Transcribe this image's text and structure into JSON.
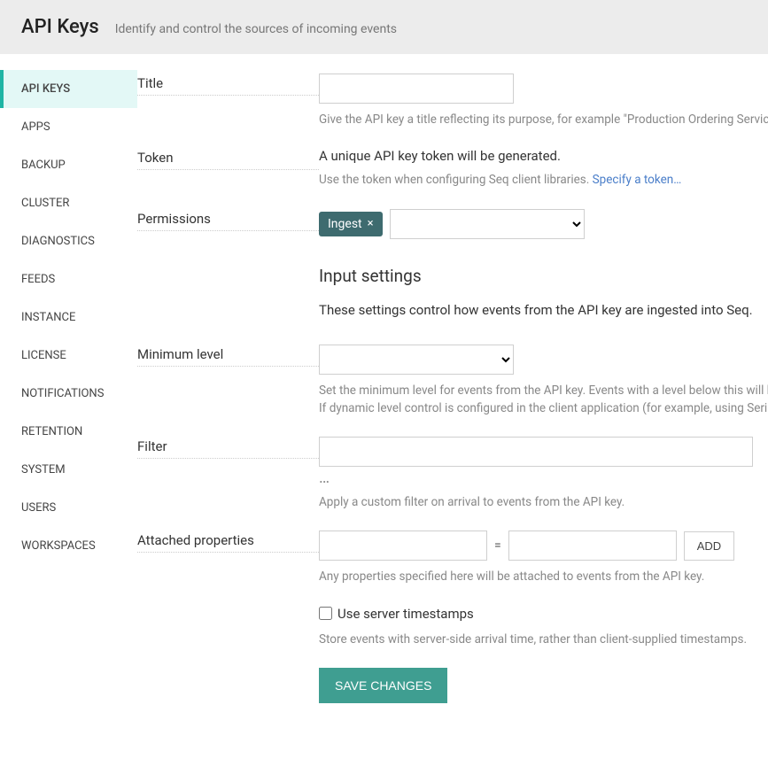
{
  "header": {
    "title": "API Keys",
    "subtitle": "Identify and control the sources of incoming events"
  },
  "sidebar": {
    "items": [
      {
        "label": "API KEYS"
      },
      {
        "label": "APPS"
      },
      {
        "label": "BACKUP"
      },
      {
        "label": "CLUSTER"
      },
      {
        "label": "DIAGNOSTICS"
      },
      {
        "label": "FEEDS"
      },
      {
        "label": "INSTANCE"
      },
      {
        "label": "LICENSE"
      },
      {
        "label": "NOTIFICATIONS"
      },
      {
        "label": "RETENTION"
      },
      {
        "label": "SYSTEM"
      },
      {
        "label": "USERS"
      },
      {
        "label": "WORKSPACES"
      }
    ]
  },
  "form": {
    "title_label": "Title",
    "title_help": "Give the API key a title reflecting its purpose, for example \"Production Ordering Service\".",
    "token_label": "Token",
    "token_text": "A unique API key token will be generated.",
    "token_help_pre": "Use the token when configuring Seq client libraries. ",
    "token_link": "Specify a token…",
    "perm_label": "Permissions",
    "perm_chip": "Ingest",
    "section_head": "Input settings",
    "section_sub": "These settings control how events from the API key are ingested into Seq.",
    "min_label": "Minimum level",
    "min_help1": "Set the minimum level for events from the API key. Events with a level below this will be discarded.",
    "min_help2_pre": "If dynamic level control is configured in the client application (for example, using ",
    "min_help2_italic": "Serilog.Sinks.Seq",
    "filter_label": "Filter",
    "filter_ellipsis": "…",
    "filter_help": "Apply a custom filter on arrival to events from the API key.",
    "props_label": "Attached properties",
    "props_eq": "=",
    "props_add": "ADD",
    "props_help": "Any properties specified here will be attached to events from the API key.",
    "ts_label": "Use server timestamps",
    "ts_help": "Store events with server-side arrival time, rather than client-supplied timestamps.",
    "save": "SAVE CHANGES"
  }
}
